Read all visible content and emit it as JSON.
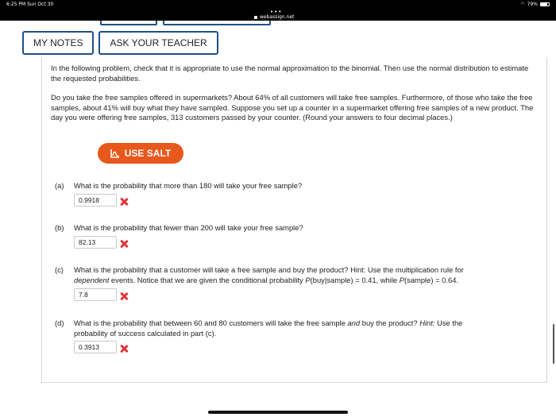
{
  "status_bar": {
    "time": "6:25 PM  Sun Oct 30",
    "battery": "79%"
  },
  "browser": {
    "dots": "•••",
    "url": "webassign.net"
  },
  "buttons": {
    "my_notes": "MY NOTES",
    "ask_teacher": "ASK YOUR TEACHER",
    "use_salt": "USE SALT"
  },
  "intro": "In the following problem, check that it is appropriate to use the normal approximation to the binomial. Then use the normal distribution to estimate the requested probabilities.",
  "problem": "Do you take the free samples offered in supermarkets? About 64% of all customers will take free samples. Furthermore, of those who take the free samples, about 41% will buy what they have sampled. Suppose you set up a counter in a supermarket offering free samples of a new product. The day you were offering free samples, 313 customers passed by your counter. (Round your answers to four decimal places.)",
  "parts": [
    {
      "label": "(a)",
      "question": "What is the probability that more than 180 will take your free sample?",
      "answer": "0.9918",
      "status": "incorrect"
    },
    {
      "label": "(b)",
      "question": "What is the probability that fewer than 200 will take your free sample?",
      "answer": "82.13",
      "status": "incorrect"
    },
    {
      "label": "(c)",
      "q1": "What is the probability that a customer will take a free sample and buy the product? Hint: Use the multiplication rule for",
      "q2_em": "dependent",
      "q2_rest": " events. Notice that we are given the conditional probability ",
      "q2_p1": "P",
      "q2_p1_arg": "(buy|sample) = 0.41, while ",
      "q2_p2": "P",
      "q2_p2_arg": "(sample) = 0.64.",
      "answer": "7.8",
      "status": "incorrect"
    },
    {
      "label": "(d)",
      "q1": "What is the probability that between 60 and 80 customers will take the free sample ",
      "q1_em": "and",
      "q1_rest": " buy the product? ",
      "hint_em": "Hint:",
      "q1_end": " Use the",
      "q2": "probability of success calculated in part (c).",
      "answer": "0.3913",
      "status": "incorrect"
    }
  ]
}
